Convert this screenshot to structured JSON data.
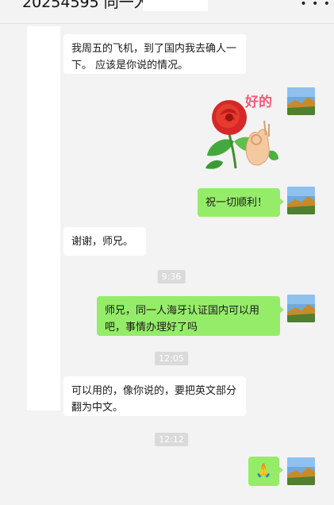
{
  "header": {
    "title": "20254595 同一人",
    "more_icon": "more-icon"
  },
  "messages": [
    {
      "type": "text",
      "side": "left",
      "text": "我周五的飞机，到了国内我去确人一下。 应该是你说的情况。"
    },
    {
      "type": "sticker",
      "side": "right",
      "text": "好的"
    },
    {
      "type": "text",
      "side": "right",
      "text": "祝一切顺利！"
    },
    {
      "type": "text",
      "side": "left",
      "text": "谢谢，师兄。"
    },
    {
      "type": "time",
      "text": "9:36"
    },
    {
      "type": "text",
      "side": "right",
      "text": "师兄，同一人海牙认证国内可以用吧，事情办理好了吗"
    },
    {
      "type": "time",
      "text": "12:05"
    },
    {
      "type": "text",
      "side": "left",
      "text": "可以用的，像你说的，要把英文部分翻为中文。"
    },
    {
      "type": "time",
      "text": "12:12"
    },
    {
      "type": "emoji",
      "side": "right",
      "text": "🙏"
    }
  ],
  "colors": {
    "background": "#f3f3f3",
    "sent_bubble": "#95ec69",
    "received_bubble": "#ffffff",
    "timestamp_bg": "#dadada"
  },
  "icons": {
    "avatar": "landscape-avatar-icon",
    "sticker": "rose-ok-hand-sticker",
    "emoji": "praying-hands-emoji"
  }
}
